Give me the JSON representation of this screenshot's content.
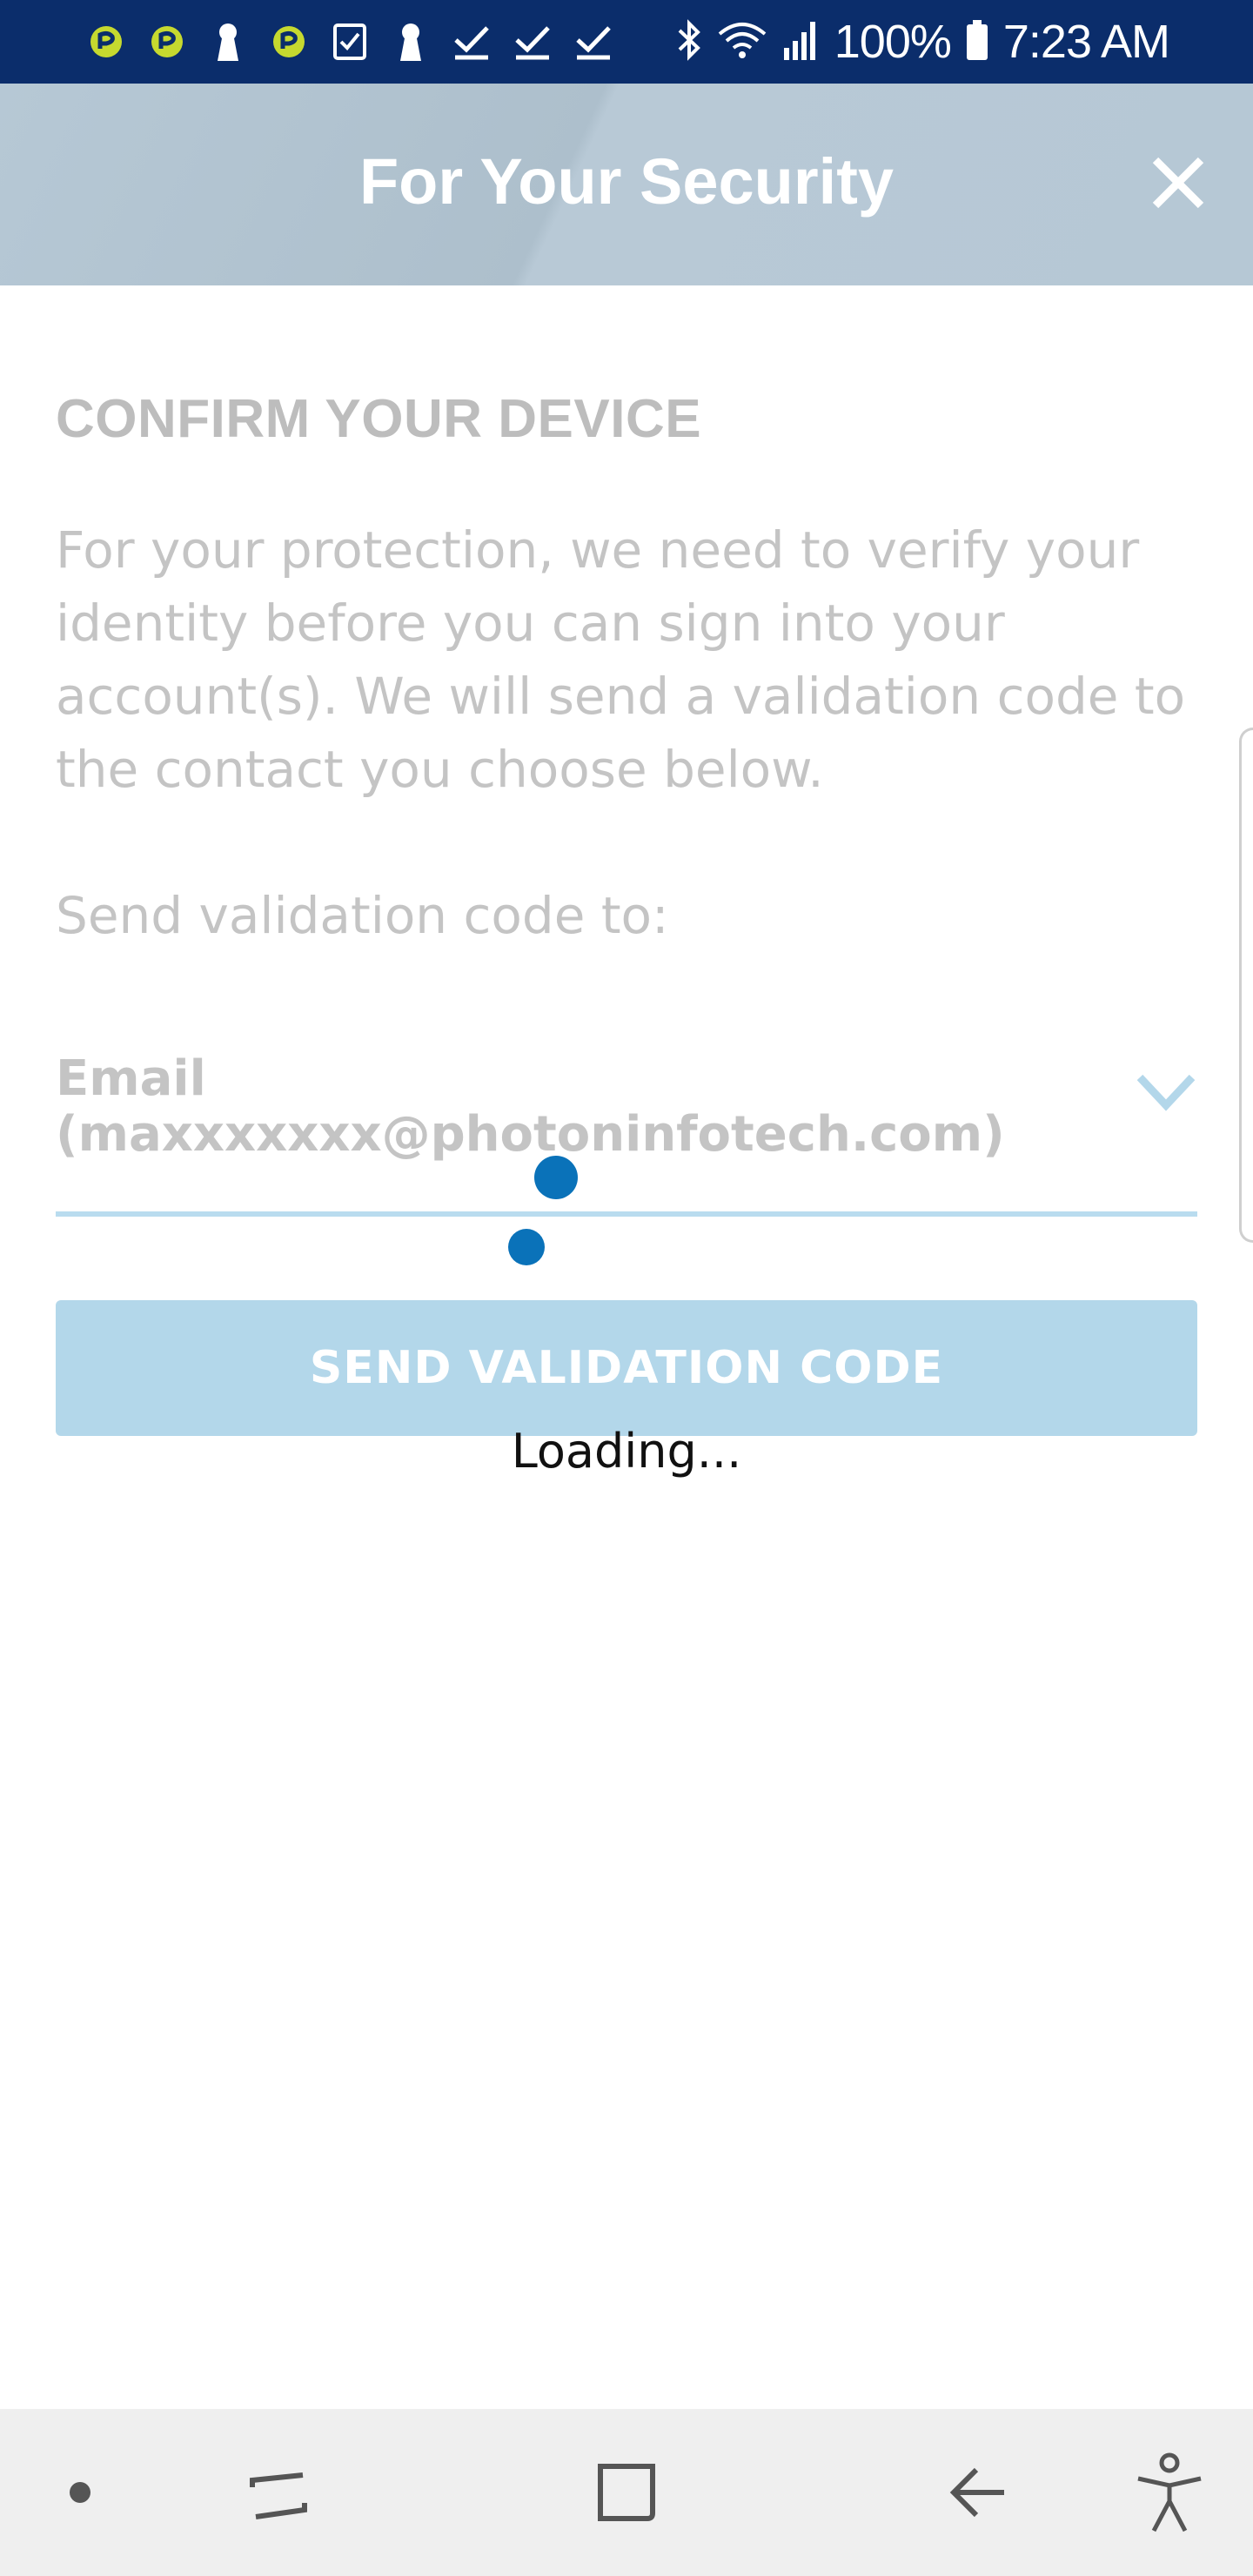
{
  "status_bar": {
    "icons": [
      "app-notification-icon",
      "app-notification-icon",
      "keyhole-icon",
      "app-notification-icon",
      "task-checkbox-icon",
      "keyhole-icon",
      "check-download-icon",
      "check-download-icon",
      "check-download-icon",
      "bluetooth-icon",
      "wifi-icon",
      "signal-icon",
      "battery-icon"
    ],
    "battery": "100%",
    "time": "7:23 AM"
  },
  "header": {
    "title": "For Your Security",
    "close_icon": "close-icon"
  },
  "main": {
    "heading": "CONFIRM YOUR DEVICE",
    "description": "For your protection, we need to verify your identity before you can sign into your account(s). We will send a validation code to the contact you choose below.",
    "send_label": "Send validation code to:",
    "contact_select": {
      "value": "Email\n(maxxxxxxx@photoninfotech.com)",
      "icon": "chevron-down-icon"
    },
    "send_button_label": "SEND VALIDATION CODE"
  },
  "loading": {
    "text": "Loading..."
  },
  "nav_bar": {
    "items": [
      "dot-icon",
      "recent-apps-icon",
      "home-icon",
      "back-icon",
      "accessibility-icon"
    ]
  },
  "colors": {
    "status_bar_bg": "#0b2d6b",
    "header_bg": "#b6c8d5",
    "accent": "#0a72b9",
    "button_bg": "#b3d7ea",
    "underline": "#b9dcef",
    "muted_text": "#c4c4c4"
  }
}
